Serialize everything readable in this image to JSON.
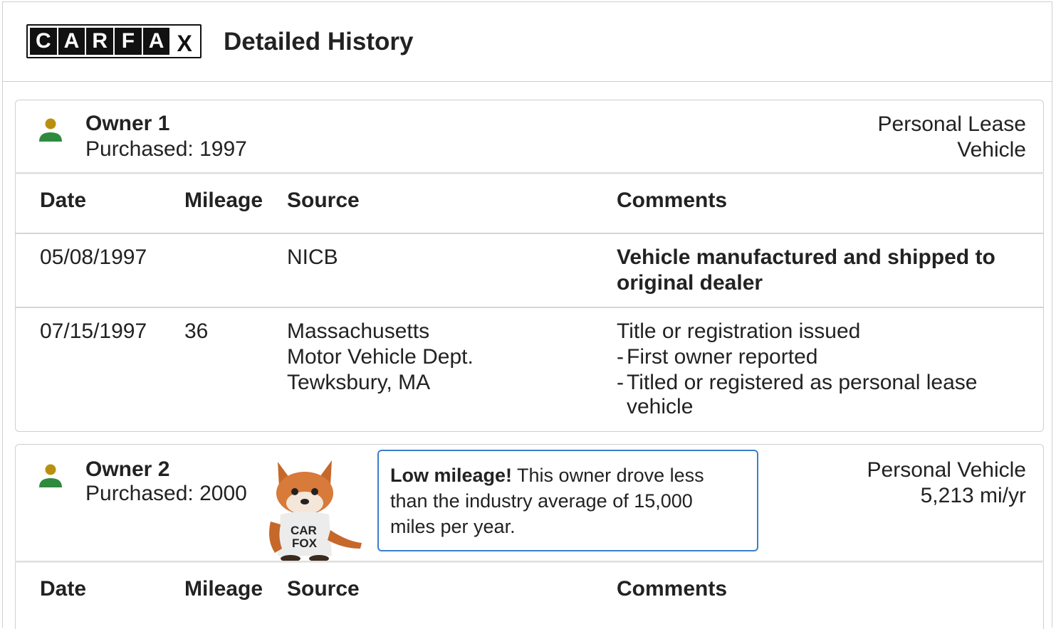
{
  "header": {
    "logo_letters": [
      "C",
      "A",
      "R",
      "F",
      "A",
      "X"
    ],
    "title": "Detailed History"
  },
  "colors": {
    "icon_head": "#b8900f",
    "icon_body": "#2e8b3e",
    "tip_border": "#3a7fc9"
  },
  "table_headers": {
    "date": "Date",
    "mileage": "Mileage",
    "source": "Source",
    "comments": "Comments"
  },
  "owners": [
    {
      "name": "Owner 1",
      "purchased": "Purchased: 1997",
      "type_line1": "Personal Lease",
      "type_line2": "Vehicle",
      "records": [
        {
          "date": "05/08/1997",
          "mileage": "",
          "source": [
            "NICB"
          ],
          "comment_title_line1": "Vehicle manufactured and shipped to",
          "comment_title_line2": "original dealer",
          "details": []
        },
        {
          "date": "07/15/1997",
          "mileage": "36",
          "source": [
            "Massachusetts",
            "Motor Vehicle Dept.",
            "Tewksbury, MA"
          ],
          "comment_title_line1": "Title or registration issued",
          "details": [
            "First owner reported",
            "Titled or registered as personal lease",
            "vehicle"
          ]
        }
      ]
    },
    {
      "name": "Owner 2",
      "purchased": "Purchased: 2000",
      "type_line1": "Personal Vehicle",
      "type_line2": "5,213 mi/yr",
      "tip_strong": "Low mileage!",
      "tip_line1_rest": " This owner drove less",
      "tip_line2": "than the industry average of 15,000",
      "tip_line3": "miles per year.",
      "mascot_shirt": [
        "CAR",
        "FOX"
      ]
    }
  ]
}
